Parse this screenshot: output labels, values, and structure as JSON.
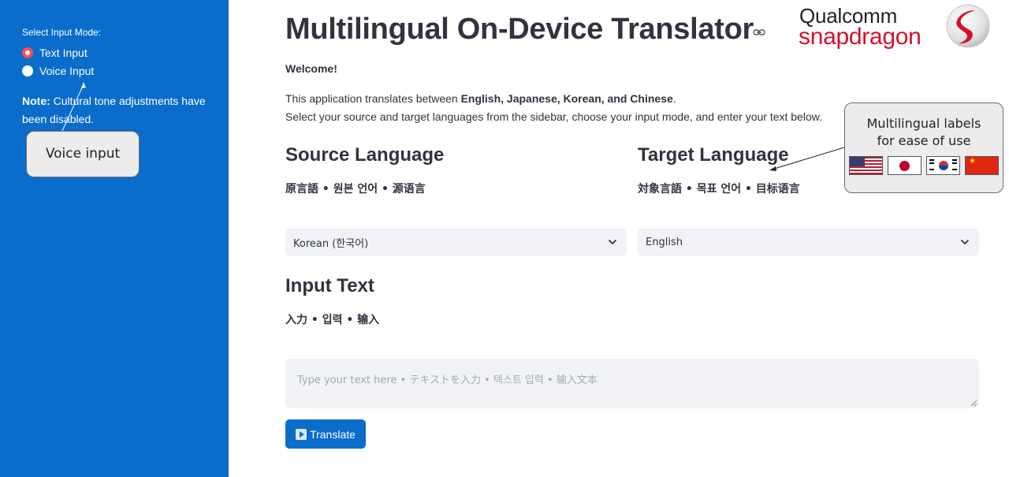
{
  "sidebar": {
    "input_mode_label": "Select Input Mode:",
    "options": [
      {
        "label": "Text Input",
        "selected": true
      },
      {
        "label": "Voice Input",
        "selected": false
      }
    ],
    "note_bold": "Note:",
    "note_text": " Cultural tone adjustments have been disabled."
  },
  "header": {
    "title": "Multilingual On-Device Translator",
    "logo_line1": "Qualcomm",
    "logo_line2": "snapdragon"
  },
  "intro": {
    "welcome": "Welcome!",
    "desc1_prefix": "This application translates between ",
    "desc1_langs": "English, Japanese, Korean, and Chinese",
    "desc1_suffix": ".",
    "desc2": "Select your source and target languages from the sidebar, choose your input mode, and enter your text below."
  },
  "source": {
    "heading": "Source Language",
    "sub": "原言語 • 원본 언어 • 源语言",
    "selected": "Korean (한국어)"
  },
  "target": {
    "heading": "Target Language",
    "sub": "対象言語 • 목표 언어 • 目标语言",
    "selected": "English"
  },
  "input": {
    "heading": "Input Text",
    "sub": "入力 • 입력 • 输入",
    "placeholder": "Type your text here • テキストを入力 • 텍스트 입력 • 输入文本",
    "value": ""
  },
  "actions": {
    "translate_label": "Translate"
  },
  "annotations": {
    "voice_callout": "Voice input",
    "multilingual_callout_line1": "Multilingual labels",
    "multilingual_callout_line2": "for ease of use",
    "flags": [
      "us-flag",
      "japan-flag",
      "korea-flag",
      "china-flag"
    ]
  },
  "colors": {
    "sidebar_bg": "#0a6ccb",
    "radio_selected": "#ff4b4b",
    "button_bg": "#0a6ccb",
    "brand_red": "#d6102a",
    "input_bg": "#f0f2f6"
  }
}
